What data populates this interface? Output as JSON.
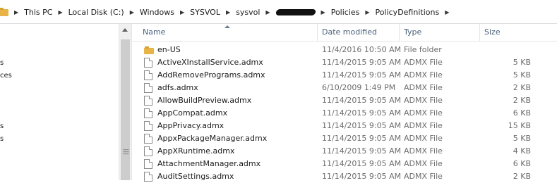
{
  "address_bar": {
    "crumbs": [
      "This PC",
      "Local Disk (C:)",
      "Windows",
      "SYSVOL",
      "sysvol",
      "Policies",
      "PolicyDefinitions"
    ]
  },
  "nav_fragments": [
    "s",
    "ces",
    "s",
    "s"
  ],
  "columns": {
    "name": "Name",
    "date": "Date modified",
    "type": "Type",
    "size": "Size"
  },
  "files": [
    {
      "name": "en-US",
      "date": "11/4/2016 10:50 AM",
      "type": "File folder",
      "size": "",
      "icon": "folder-icon"
    },
    {
      "name": "ActiveXInstallService.admx",
      "date": "11/14/2015 9:05 AM",
      "type": "ADMX File",
      "size": "5 KB",
      "icon": "file-icon"
    },
    {
      "name": "AddRemovePrograms.admx",
      "date": "11/14/2015 9:05 AM",
      "type": "ADMX File",
      "size": "5 KB",
      "icon": "file-icon"
    },
    {
      "name": "adfs.admx",
      "date": "6/10/2009 1:49 PM",
      "type": "ADMX File",
      "size": "2 KB",
      "icon": "file-icon"
    },
    {
      "name": "AllowBuildPreview.admx",
      "date": "11/14/2015 9:05 AM",
      "type": "ADMX File",
      "size": "2 KB",
      "icon": "file-icon"
    },
    {
      "name": "AppCompat.admx",
      "date": "11/14/2015 9:05 AM",
      "type": "ADMX File",
      "size": "6 KB",
      "icon": "file-icon"
    },
    {
      "name": "AppPrivacy.admx",
      "date": "11/14/2015 9:05 AM",
      "type": "ADMX File",
      "size": "15 KB",
      "icon": "file-icon"
    },
    {
      "name": "AppxPackageManager.admx",
      "date": "11/14/2015 9:05 AM",
      "type": "ADMX File",
      "size": "5 KB",
      "icon": "file-icon"
    },
    {
      "name": "AppXRuntime.admx",
      "date": "11/14/2015 9:05 AM",
      "type": "ADMX File",
      "size": "4 KB",
      "icon": "file-icon"
    },
    {
      "name": "AttachmentManager.admx",
      "date": "11/14/2015 9:05 AM",
      "type": "ADMX File",
      "size": "6 KB",
      "icon": "file-icon"
    },
    {
      "name": "AuditSettings.admx",
      "date": "11/14/2015 9:05 AM",
      "type": "ADMX File",
      "size": "2 KB",
      "icon": "file-icon"
    }
  ]
}
